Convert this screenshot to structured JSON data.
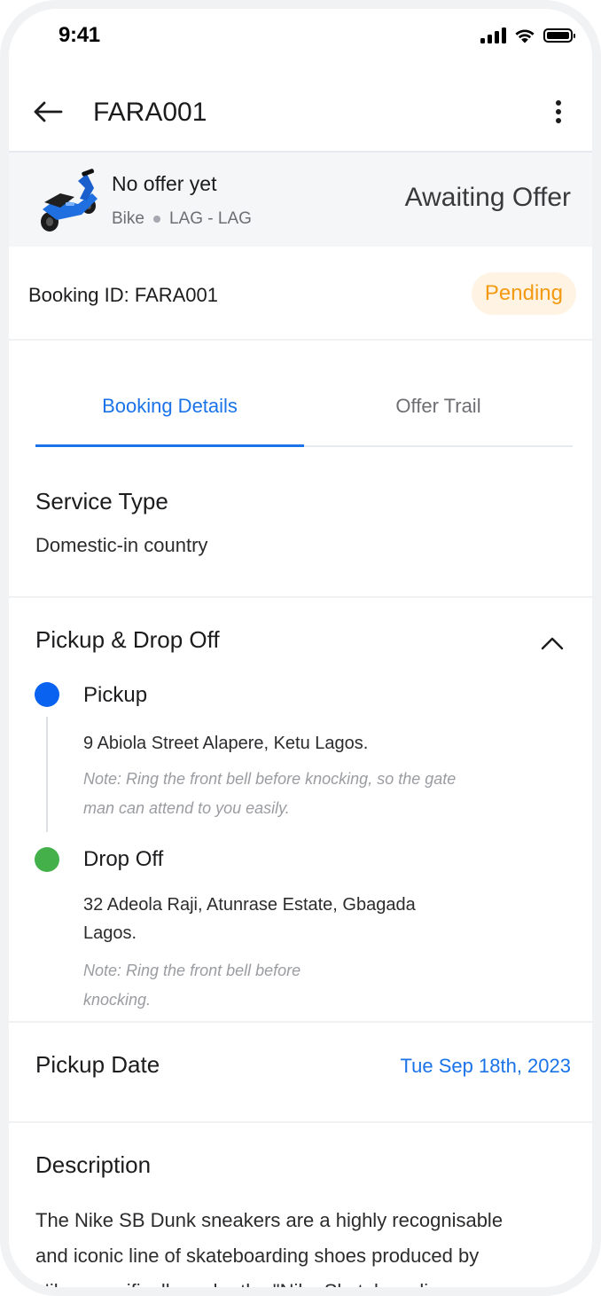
{
  "status_bar": {
    "time": "9:41",
    "battery_level": 1.0
  },
  "header": {
    "title": "FARA001",
    "back_icon": "arrow-left-icon",
    "more_icon": "more-vertical-icon"
  },
  "offer": {
    "title": "No offer yet",
    "vehicle": "Bike",
    "route": "LAG - LAG",
    "status": "Awaiting Offer",
    "image": "scooter-illustration"
  },
  "booking": {
    "id_label": "Booking ID: FARA001",
    "status_badge": "Pending",
    "badge_color": "#f29a12"
  },
  "tabs": [
    {
      "label": "Booking Details",
      "active": true
    },
    {
      "label": "Offer Trail",
      "active": false
    }
  ],
  "service": {
    "heading": "Service Type",
    "value": "Domestic-in country"
  },
  "pickup_dropoff": {
    "heading": "Pickup & Drop Off",
    "pickup": {
      "label": "Pickup",
      "address": "9 Abiola Street Alapere, Ketu Lagos.",
      "note_line1": "Note: Ring the front bell before knocking, so the gate",
      "note_line2": "man can attend to you easily.",
      "color": "#0a62f0"
    },
    "dropoff": {
      "label": "Drop Off",
      "address_line1": "32 Adeola Raji, Atunrase Estate, Gbagada",
      "address_line2": "Lagos.",
      "note_line1": "Note: Ring the front bell before",
      "note_line2": "knocking.",
      "color": "#43b04a"
    }
  },
  "pickup_date": {
    "label": "Pickup Date",
    "value": "Tue Sep 18th, 2023"
  },
  "description": {
    "heading": "Description",
    "line1": "The Nike SB Dunk sneakers are a highly recognisable",
    "line2": "and iconic line of skateboarding shoes produced by",
    "line3": "Nike, specifically under the \"Nike Skateboarding,"
  },
  "colors": {
    "accent": "#1a73e8",
    "badge_bg": "#fff3e4",
    "strip_bg": "#f4f6f8"
  }
}
